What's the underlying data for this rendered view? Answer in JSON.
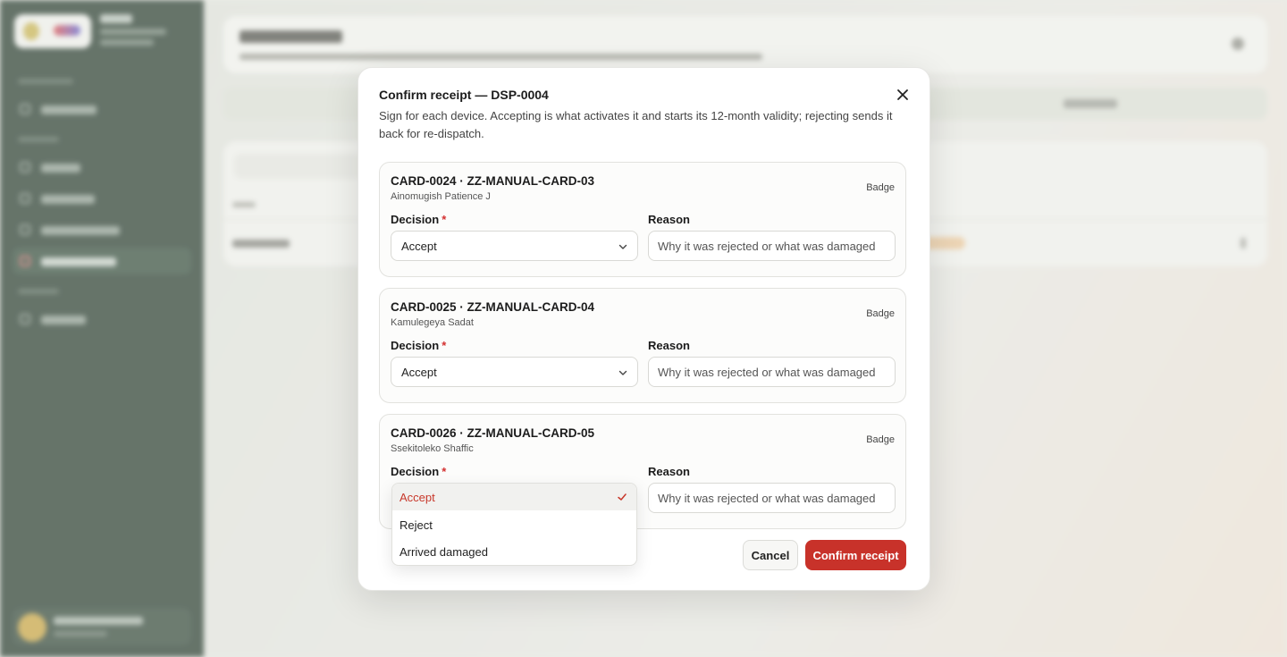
{
  "modal": {
    "title": "Confirm receipt — DSP-0004",
    "description": "Sign for each device. Accepting is what activates it and starts its 12-month validity; rejecting sends it back for re-dispatch.",
    "close_icon": "close-icon",
    "decision_label": "Decision",
    "required_mark": "*",
    "reason_label": "Reason",
    "reason_placeholder": "Why it was rejected or what was damaged",
    "devices": [
      {
        "code": "CARD-0024 · ZZ-MANUAL-CARD-03",
        "holder": "Ainomugish Patience J",
        "type": "Badge",
        "decision": "Accept"
      },
      {
        "code": "CARD-0025 · ZZ-MANUAL-CARD-04",
        "holder": "Kamulegeya Sadat",
        "type": "Badge",
        "decision": "Accept"
      },
      {
        "code": "CARD-0026 · ZZ-MANUAL-CARD-05",
        "holder": "Ssekitoleko Shaffic",
        "type": "Badge",
        "decision": "Accept"
      }
    ],
    "dropdown": {
      "options": [
        "Accept",
        "Reject",
        "Arrived damaged"
      ],
      "selected": "Accept"
    },
    "cancel_label": "Cancel",
    "confirm_label": "Confirm receipt"
  },
  "colors": {
    "accent": "#c8322a",
    "sidebar": "#1f3326",
    "required": "#d32f2f"
  }
}
